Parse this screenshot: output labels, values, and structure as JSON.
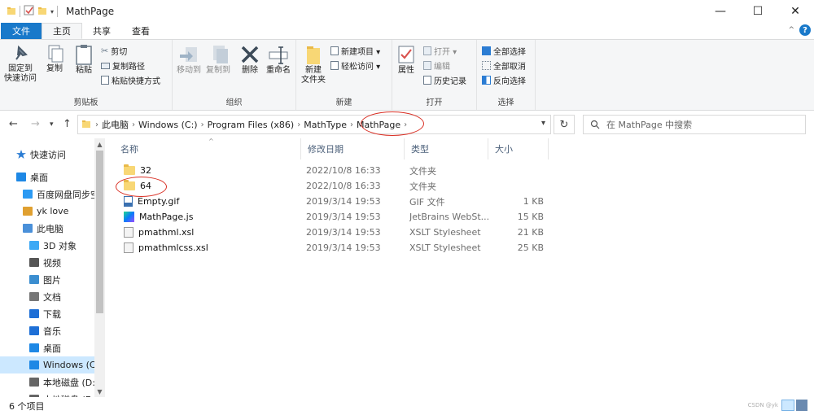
{
  "window": {
    "title": "MathPage",
    "controls": [
      "—",
      "☐",
      "✕"
    ]
  },
  "ribbon_tabs": [
    {
      "label": "文件"
    },
    {
      "label": "主页"
    },
    {
      "label": "共享"
    },
    {
      "label": "查看"
    }
  ],
  "ribbon": {
    "clipboard": {
      "label": "剪贴板",
      "pin": "固定到\n快速访问",
      "copy": "复制",
      "paste": "粘贴",
      "cut": "剪切",
      "copy_path": "复制路径",
      "paste_shortcut": "粘贴快捷方式"
    },
    "organize": {
      "label": "组织",
      "move_to": "移动到",
      "copy_to": "复制到",
      "delete": "删除",
      "rename": "重命名"
    },
    "new": {
      "label": "新建",
      "new_folder": "新建\n文件夹",
      "new_item": "新建项目 ▾",
      "easy_access": "轻松访问 ▾"
    },
    "open": {
      "label": "打开",
      "properties": "属性",
      "open": "打开 ▾",
      "edit": "编辑",
      "history": "历史记录"
    },
    "select": {
      "label": "选择",
      "select_all": "全部选择",
      "select_none": "全部取消",
      "invert": "反向选择"
    }
  },
  "address": {
    "crumbs": [
      "此电脑",
      "Windows (C:)",
      "Program Files (x86)",
      "MathType",
      "MathPage"
    ],
    "search_placeholder": "在 MathPage 中搜索"
  },
  "nav_pane": {
    "items": [
      {
        "label": "快速访问",
        "icon": "star-icon",
        "color": "#2b7cd3"
      },
      {
        "label": "桌面",
        "icon": "desktop-icon",
        "color": "#1e88e5"
      },
      {
        "label": "百度网盘同步空",
        "icon": "baidu-icon",
        "color": "#2b9af3"
      },
      {
        "label": "yk love",
        "icon": "user-icon",
        "color": "#e0a030"
      },
      {
        "label": "此电脑",
        "icon": "pc-icon",
        "color": "#4a90d9"
      },
      {
        "label": "3D 对象",
        "icon": "cube-icon",
        "color": "#3da9f5"
      },
      {
        "label": "视频",
        "icon": "video-icon",
        "color": "#555555"
      },
      {
        "label": "图片",
        "icon": "picture-icon",
        "color": "#3b8ed0"
      },
      {
        "label": "文档",
        "icon": "document-icon",
        "color": "#777777"
      },
      {
        "label": "下载",
        "icon": "download-icon",
        "color": "#1e6fd6"
      },
      {
        "label": "音乐",
        "icon": "music-icon",
        "color": "#1e6fd6"
      },
      {
        "label": "桌面",
        "icon": "desktop-icon",
        "color": "#1e88e5"
      },
      {
        "label": "Windows (C:)",
        "icon": "drive-windows-icon",
        "color": "#1e88e5"
      },
      {
        "label": "本地磁盘 (D:)",
        "icon": "drive-icon",
        "color": "#666666"
      },
      {
        "label": "本地磁盘 (E:)",
        "icon": "drive-icon",
        "color": "#666666"
      }
    ]
  },
  "columns": {
    "name": "名称",
    "date": "修改日期",
    "type": "类型",
    "size": "大小"
  },
  "files": [
    {
      "name": "32",
      "date": "2022/10/8 16:33",
      "type": "文件夹",
      "size": "",
      "icon": "folder-icon"
    },
    {
      "name": "64",
      "date": "2022/10/8 16:33",
      "type": "文件夹",
      "size": "",
      "icon": "folder-icon"
    },
    {
      "name": "Empty.gif",
      "date": "2019/3/14 19:53",
      "type": "GIF 文件",
      "size": "1 KB",
      "icon": "gif-file-icon"
    },
    {
      "name": "MathPage.js",
      "date": "2019/3/14 19:53",
      "type": "JetBrains WebSt...",
      "size": "15 KB",
      "icon": "webstorm-file-icon"
    },
    {
      "name": "pmathml.xsl",
      "date": "2019/3/14 19:53",
      "type": "XSLT Stylesheet",
      "size": "21 KB",
      "icon": "xsl-file-icon"
    },
    {
      "name": "pmathmlcss.xsl",
      "date": "2019/3/14 19:53",
      "type": "XSLT Stylesheet",
      "size": "25 KB",
      "icon": "xsl-file-icon"
    }
  ],
  "status": {
    "count": "6 个项目",
    "watermark": "CSDN @yk"
  },
  "colors": {
    "accent": "#1979ca",
    "selection": "#cce8ff",
    "annotation": "#d93025"
  }
}
